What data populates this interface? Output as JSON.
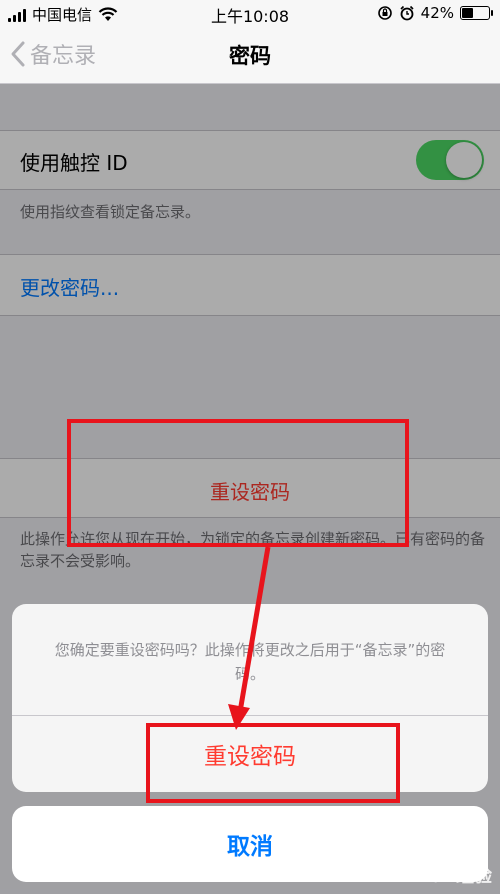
{
  "status_bar": {
    "carrier": "中国电信",
    "time": "上午10:08",
    "battery_percent": "42%",
    "battery_level": 0.42
  },
  "nav": {
    "back_label": "备忘录",
    "title": "密码"
  },
  "settings": {
    "touch_id_label": "使用触控 ID",
    "touch_id_enabled": true,
    "touch_id_footnote": "使用指纹查看锁定备忘录。",
    "change_password_label": "更改密码...",
    "reset_password_label": "重设密码",
    "reset_footnote": "此操作允许您从现在开始，为锁定的备忘录创建新密码。已有密码的备忘录不会受影响。"
  },
  "action_sheet": {
    "message": "您确定要重设密码吗？此操作将更改之后用于“备忘录”的密码。",
    "confirm_label": "重设密码",
    "cancel_label": "取消"
  },
  "watermark": "Bai 经验",
  "colors": {
    "accent_blue": "#007aff",
    "destructive_red": "#ff3b30",
    "toggle_green": "#4cd964",
    "annotation_red": "#e8141c"
  },
  "icons": [
    "signal-icon",
    "wifi-icon",
    "rotation-lock-icon",
    "alarm-icon",
    "battery-icon",
    "chevron-left-icon"
  ]
}
